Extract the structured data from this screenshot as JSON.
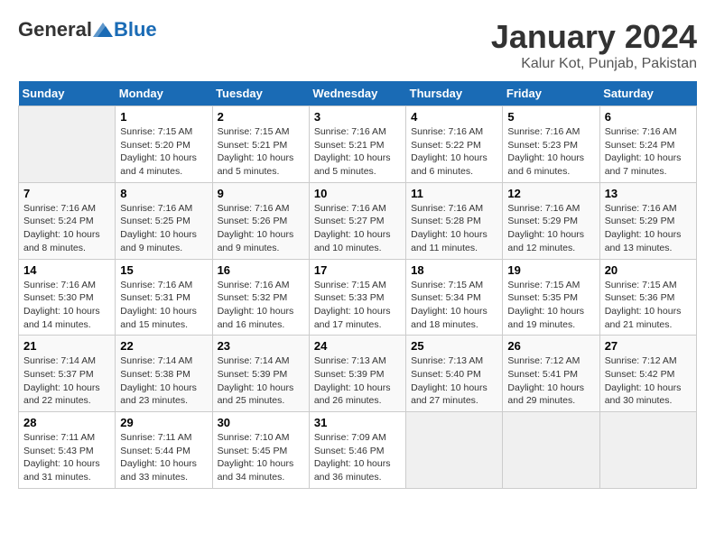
{
  "header": {
    "logo_general": "General",
    "logo_blue": "Blue",
    "title": "January 2024",
    "subtitle": "Kalur Kot, Punjab, Pakistan"
  },
  "columns": [
    "Sunday",
    "Monday",
    "Tuesday",
    "Wednesday",
    "Thursday",
    "Friday",
    "Saturday"
  ],
  "rows": [
    [
      {
        "date": "",
        "info": ""
      },
      {
        "date": "1",
        "info": "Sunrise: 7:15 AM\nSunset: 5:20 PM\nDaylight: 10 hours\nand 4 minutes."
      },
      {
        "date": "2",
        "info": "Sunrise: 7:15 AM\nSunset: 5:21 PM\nDaylight: 10 hours\nand 5 minutes."
      },
      {
        "date": "3",
        "info": "Sunrise: 7:16 AM\nSunset: 5:21 PM\nDaylight: 10 hours\nand 5 minutes."
      },
      {
        "date": "4",
        "info": "Sunrise: 7:16 AM\nSunset: 5:22 PM\nDaylight: 10 hours\nand 6 minutes."
      },
      {
        "date": "5",
        "info": "Sunrise: 7:16 AM\nSunset: 5:23 PM\nDaylight: 10 hours\nand 6 minutes."
      },
      {
        "date": "6",
        "info": "Sunrise: 7:16 AM\nSunset: 5:24 PM\nDaylight: 10 hours\nand 7 minutes."
      }
    ],
    [
      {
        "date": "7",
        "info": "Sunrise: 7:16 AM\nSunset: 5:24 PM\nDaylight: 10 hours\nand 8 minutes."
      },
      {
        "date": "8",
        "info": "Sunrise: 7:16 AM\nSunset: 5:25 PM\nDaylight: 10 hours\nand 9 minutes."
      },
      {
        "date": "9",
        "info": "Sunrise: 7:16 AM\nSunset: 5:26 PM\nDaylight: 10 hours\nand 9 minutes."
      },
      {
        "date": "10",
        "info": "Sunrise: 7:16 AM\nSunset: 5:27 PM\nDaylight: 10 hours\nand 10 minutes."
      },
      {
        "date": "11",
        "info": "Sunrise: 7:16 AM\nSunset: 5:28 PM\nDaylight: 10 hours\nand 11 minutes."
      },
      {
        "date": "12",
        "info": "Sunrise: 7:16 AM\nSunset: 5:29 PM\nDaylight: 10 hours\nand 12 minutes."
      },
      {
        "date": "13",
        "info": "Sunrise: 7:16 AM\nSunset: 5:29 PM\nDaylight: 10 hours\nand 13 minutes."
      }
    ],
    [
      {
        "date": "14",
        "info": "Sunrise: 7:16 AM\nSunset: 5:30 PM\nDaylight: 10 hours\nand 14 minutes."
      },
      {
        "date": "15",
        "info": "Sunrise: 7:16 AM\nSunset: 5:31 PM\nDaylight: 10 hours\nand 15 minutes."
      },
      {
        "date": "16",
        "info": "Sunrise: 7:16 AM\nSunset: 5:32 PM\nDaylight: 10 hours\nand 16 minutes."
      },
      {
        "date": "17",
        "info": "Sunrise: 7:15 AM\nSunset: 5:33 PM\nDaylight: 10 hours\nand 17 minutes."
      },
      {
        "date": "18",
        "info": "Sunrise: 7:15 AM\nSunset: 5:34 PM\nDaylight: 10 hours\nand 18 minutes."
      },
      {
        "date": "19",
        "info": "Sunrise: 7:15 AM\nSunset: 5:35 PM\nDaylight: 10 hours\nand 19 minutes."
      },
      {
        "date": "20",
        "info": "Sunrise: 7:15 AM\nSunset: 5:36 PM\nDaylight: 10 hours\nand 21 minutes."
      }
    ],
    [
      {
        "date": "21",
        "info": "Sunrise: 7:14 AM\nSunset: 5:37 PM\nDaylight: 10 hours\nand 22 minutes."
      },
      {
        "date": "22",
        "info": "Sunrise: 7:14 AM\nSunset: 5:38 PM\nDaylight: 10 hours\nand 23 minutes."
      },
      {
        "date": "23",
        "info": "Sunrise: 7:14 AM\nSunset: 5:39 PM\nDaylight: 10 hours\nand 25 minutes."
      },
      {
        "date": "24",
        "info": "Sunrise: 7:13 AM\nSunset: 5:39 PM\nDaylight: 10 hours\nand 26 minutes."
      },
      {
        "date": "25",
        "info": "Sunrise: 7:13 AM\nSunset: 5:40 PM\nDaylight: 10 hours\nand 27 minutes."
      },
      {
        "date": "26",
        "info": "Sunrise: 7:12 AM\nSunset: 5:41 PM\nDaylight: 10 hours\nand 29 minutes."
      },
      {
        "date": "27",
        "info": "Sunrise: 7:12 AM\nSunset: 5:42 PM\nDaylight: 10 hours\nand 30 minutes."
      }
    ],
    [
      {
        "date": "28",
        "info": "Sunrise: 7:11 AM\nSunset: 5:43 PM\nDaylight: 10 hours\nand 31 minutes."
      },
      {
        "date": "29",
        "info": "Sunrise: 7:11 AM\nSunset: 5:44 PM\nDaylight: 10 hours\nand 33 minutes."
      },
      {
        "date": "30",
        "info": "Sunrise: 7:10 AM\nSunset: 5:45 PM\nDaylight: 10 hours\nand 34 minutes."
      },
      {
        "date": "31",
        "info": "Sunrise: 7:09 AM\nSunset: 5:46 PM\nDaylight: 10 hours\nand 36 minutes."
      },
      {
        "date": "",
        "info": ""
      },
      {
        "date": "",
        "info": ""
      },
      {
        "date": "",
        "info": ""
      }
    ]
  ]
}
